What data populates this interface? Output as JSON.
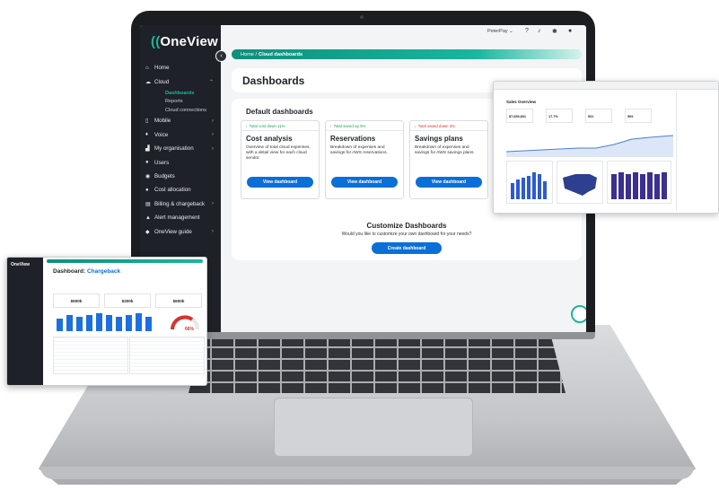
{
  "app": {
    "logo": "OneView"
  },
  "topbar": {
    "user": "PeterPay"
  },
  "sidebar": {
    "items": [
      {
        "label": "Home",
        "icon": "home-icon",
        "chevron": false
      },
      {
        "label": "Cloud",
        "icon": "cloud-icon",
        "chevron": true,
        "expanded": true,
        "children": [
          "Dashboards",
          "Reports",
          "Cloud connections"
        ],
        "active_child": "Dashboards"
      },
      {
        "label": "Mobile",
        "icon": "mobile-icon",
        "chevron": true
      },
      {
        "label": "Voice",
        "icon": "microphone-icon",
        "chevron": true
      },
      {
        "label": "My organisation",
        "icon": "organisation-icon",
        "chevron": true
      },
      {
        "label": "Users",
        "icon": "users-icon",
        "chevron": false
      },
      {
        "label": "Budgets",
        "icon": "budget-icon",
        "chevron": false
      },
      {
        "label": "Cost allocation",
        "icon": "cost-allocation-icon",
        "chevron": false
      },
      {
        "label": "Billing & chargeback",
        "icon": "billing-icon",
        "chevron": true
      },
      {
        "label": "Alert management",
        "icon": "bell-icon",
        "chevron": false
      },
      {
        "label": "OneView guide",
        "icon": "guide-icon",
        "chevron": true
      }
    ]
  },
  "breadcrumb": {
    "home": "Home /",
    "current": "Cloud dashboards"
  },
  "page": {
    "title": "Dashboards"
  },
  "default_dashboards": {
    "heading": "Default dashboards",
    "tiles": [
      {
        "tag": "Total cost down 11%",
        "tag_color": "#1b9e56",
        "arrow": "↓",
        "title": "Cost analysis",
        "description": "Overview of total cloud expenses, with a detail view for each cloud sendor.",
        "button": "View dashboard"
      },
      {
        "tag": "Total saved up 5%",
        "tag_color": "#1b9e56",
        "arrow": "↑",
        "title": "Reservations",
        "description": "Breakdown of expenses and savings for AWS reservations.",
        "button": "View dashboard"
      },
      {
        "tag": "Total saved down 3%",
        "tag_color": "#d8322a",
        "arrow": "↓",
        "title": "Savings plans",
        "description": "Breakdown of expenses and savings for AWS savings plans.",
        "button": "View dashboard"
      }
    ]
  },
  "customize": {
    "title": "Customize Dashboards",
    "subtitle": "Would you like to customize your own dashboard for your needs?",
    "button": "Create dashboard"
  },
  "sales_overlay": {
    "title": "Sales Overview",
    "kpis": [
      "$7,659,831",
      "17.7%",
      "531",
      "509"
    ]
  },
  "chargeback_overlay": {
    "logo": "OneView",
    "title_prefix": "Dashboard:",
    "title_value": "Chargeback",
    "kpis": [
      "$900k",
      "$300k",
      "$600k"
    ],
    "gauge_value": "66%"
  },
  "colors": {
    "accent": "#1bb79a",
    "primary_button": "#0a6fd6",
    "sidebar_bg": "#1e2228"
  }
}
